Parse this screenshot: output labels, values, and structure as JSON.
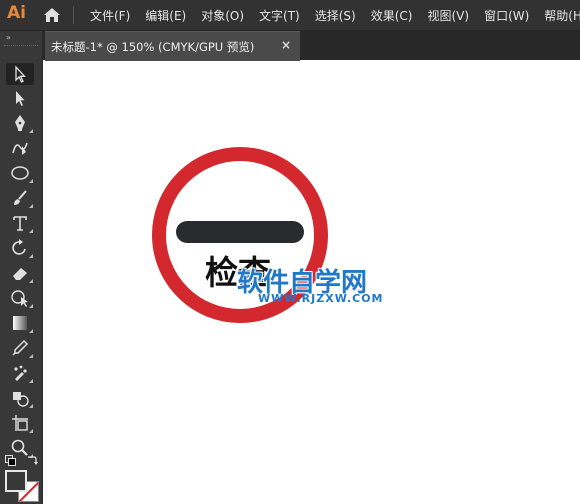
{
  "app": {
    "logo": "Ai"
  },
  "menu": [
    "文件(F)",
    "编辑(E)",
    "对象(O)",
    "文字(T)",
    "选择(S)",
    "效果(C)",
    "视图(V)",
    "窗口(W)",
    "帮助(H)"
  ],
  "document_tab": {
    "title": "未标题-1* @ 150% (CMYK/GPU 预览)",
    "close": "×"
  },
  "toolbar": {
    "collapse": "»",
    "tools": [
      "selection-tool",
      "direct-selection-tool",
      "pen-tool",
      "curvature-tool",
      "ellipse-tool",
      "paintbrush-tool",
      "type-tool",
      "rotate-tool",
      "eraser-tool",
      "shape-builder-tool",
      "gradient-tool",
      "eyedropper-tool",
      "symbol-sprayer-tool",
      "live-paint-tool",
      "artboard-tool",
      "zoom-tool"
    ]
  },
  "canvas": {
    "sign_text": "检查",
    "ring_color": "#d3282d",
    "bar_color": "#2a2b2f",
    "watermark": "软件自学网",
    "watermark_url": "WWW.RJZXW.COM"
  }
}
